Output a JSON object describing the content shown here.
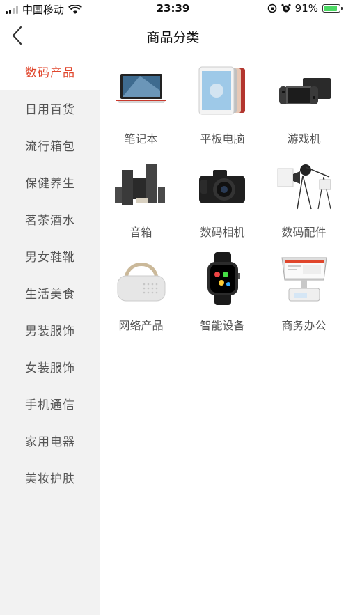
{
  "status_bar": {
    "carrier": "中国移动",
    "time": "23:39",
    "battery": "91%",
    "battery_level": 0.91
  },
  "header": {
    "title": "商品分类"
  },
  "sidebar": {
    "items": [
      {
        "label": "数码产品",
        "active": true
      },
      {
        "label": "日用百货"
      },
      {
        "label": "流行箱包"
      },
      {
        "label": "保健养生"
      },
      {
        "label": "茗茶酒水"
      },
      {
        "label": "男女鞋靴"
      },
      {
        "label": "生活美食"
      },
      {
        "label": "男装服饰"
      },
      {
        "label": "女装服饰"
      },
      {
        "label": "手机通信"
      },
      {
        "label": "家用电器"
      },
      {
        "label": "美妆护肤"
      }
    ]
  },
  "categories": [
    {
      "label": "笔记本",
      "icon": "laptop-icon"
    },
    {
      "label": "平板电脑",
      "icon": "tablet-icon"
    },
    {
      "label": "游戏机",
      "icon": "game-console-icon"
    },
    {
      "label": "音箱",
      "icon": "speaker-icon"
    },
    {
      "label": "数码相机",
      "icon": "camera-icon"
    },
    {
      "label": "数码配件",
      "icon": "studio-light-icon"
    },
    {
      "label": "网络产品",
      "icon": "projector-icon"
    },
    {
      "label": "智能设备",
      "icon": "smartwatch-icon"
    },
    {
      "label": "商务办公",
      "icon": "pos-terminal-icon"
    }
  ],
  "colors": {
    "accent": "#e0462c",
    "sidebar_bg": "#f2f2f2"
  }
}
